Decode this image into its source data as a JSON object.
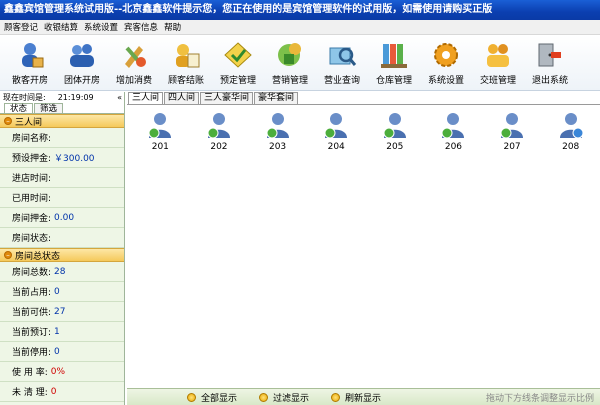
{
  "window": {
    "title": "鑫鑫宾馆管理系统试用版--北京鑫鑫软件提示您，您正在使用的是宾馆管理软件的试用版，如需使用请购买正版"
  },
  "menu": [
    "顾客登记",
    "收银结算",
    "系统设置",
    "宾客信息",
    "帮助"
  ],
  "toolbar": [
    {
      "label": "散客开房",
      "icon": "guest-checkin-icon"
    },
    {
      "label": "团体开房",
      "icon": "group-checkin-icon"
    },
    {
      "label": "增加消费",
      "icon": "add-consumption-icon"
    },
    {
      "label": "顾客结账",
      "icon": "checkout-icon"
    },
    {
      "label": "预定管理",
      "icon": "reservation-icon"
    },
    {
      "label": "营销管理",
      "icon": "marketing-icon"
    },
    {
      "label": "营业查询",
      "icon": "business-query-icon"
    },
    {
      "label": "仓库管理",
      "icon": "warehouse-icon"
    },
    {
      "label": "系统设置",
      "icon": "gear-icon"
    },
    {
      "label": "交班管理",
      "icon": "shift-icon"
    },
    {
      "label": "退出系统",
      "icon": "exit-icon"
    }
  ],
  "left": {
    "time_label": "现在时间是:",
    "time_value": "21:19:09",
    "pin": "«",
    "tabs": [
      "状态",
      "筛选"
    ],
    "room_section": {
      "title": "三人间",
      "fields": [
        {
          "label": "房间名称:",
          "value": ""
        },
        {
          "label": "预设押金:",
          "value": "￥300.00"
        },
        {
          "label": "进店时间:",
          "value": ""
        },
        {
          "label": "已用时间:",
          "value": ""
        },
        {
          "label": "房间押金:",
          "value": "0.00"
        },
        {
          "label": "房间状态:",
          "value": ""
        }
      ]
    },
    "summary_section": {
      "title": "房间总状态",
      "fields": [
        {
          "label": "房间总数:",
          "value": "28"
        },
        {
          "label": "当前占用:",
          "value": "0"
        },
        {
          "label": "当前可供:",
          "value": "27"
        },
        {
          "label": "当前预订:",
          "value": "1"
        },
        {
          "label": "当前停用:",
          "value": "0"
        },
        {
          "label": "使 用 率:",
          "value": "0%"
        },
        {
          "label": "未 清 理:",
          "value": "0"
        }
      ]
    }
  },
  "main": {
    "tabs": [
      "三人间",
      "四人间",
      "三人豪华间",
      "豪华套间"
    ],
    "rooms": [
      {
        "label": "201",
        "status": "available"
      },
      {
        "label": "202",
        "status": "available"
      },
      {
        "label": "203",
        "status": "available"
      },
      {
        "label": "204",
        "status": "available"
      },
      {
        "label": "205",
        "status": "available"
      },
      {
        "label": "206",
        "status": "available"
      },
      {
        "label": "207",
        "status": "available"
      },
      {
        "label": "208",
        "status": "reserved"
      }
    ]
  },
  "bottom": {
    "buttons": [
      "全部显示",
      "过滤显示",
      "刷新显示"
    ],
    "hint": "拖动下方线条调整显示比例"
  },
  "colors": {
    "title_bar": "#0b3fb0",
    "section_header": "#f5c95b",
    "left_panel": "#eef6e6",
    "value_blue": "#0033aa",
    "value_red": "#d00000"
  }
}
